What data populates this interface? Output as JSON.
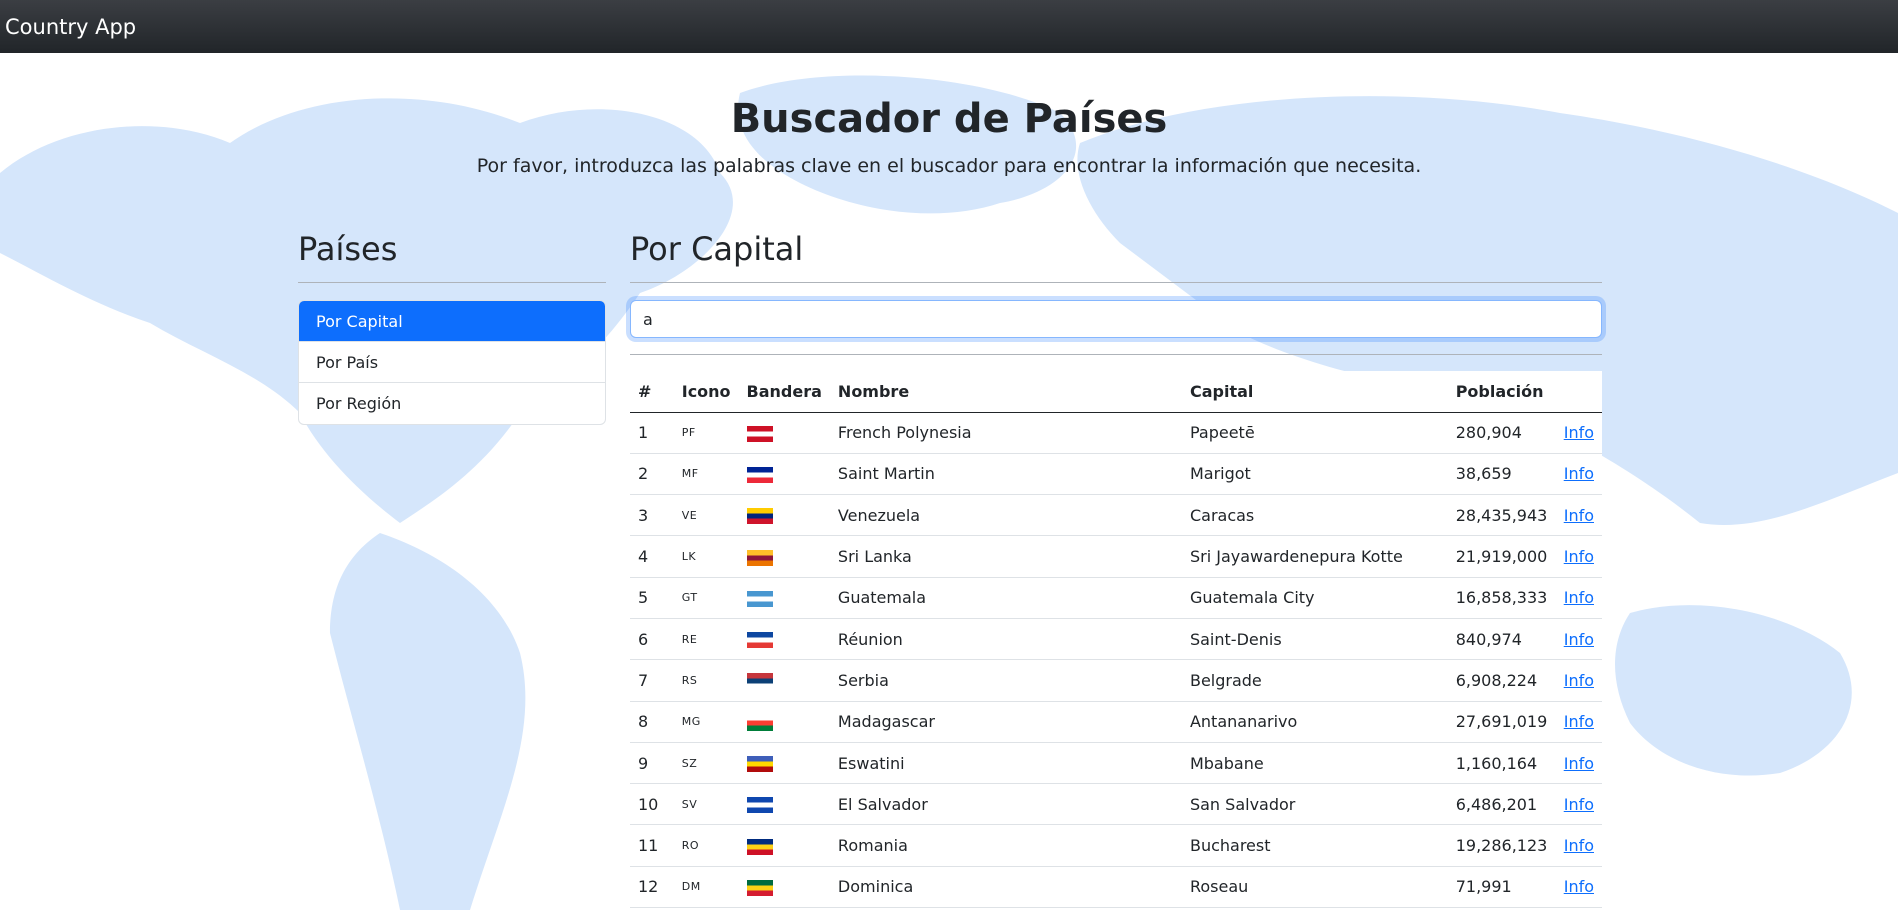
{
  "navbar": {
    "brand": "Country App"
  },
  "hero": {
    "title": "Buscador de Países",
    "subtitle": "Por favor, introduzca las palabras clave en el buscador para encontrar la información que necesita."
  },
  "sidebar": {
    "title": "Países",
    "items": [
      {
        "label": "Por Capital",
        "active": true
      },
      {
        "label": "Por País",
        "active": false
      },
      {
        "label": "Por Región",
        "active": false
      }
    ]
  },
  "main": {
    "title": "Por Capital",
    "search_value": "a"
  },
  "table": {
    "headers": [
      "#",
      "Icono",
      "Bandera",
      "Nombre",
      "Capital",
      "Población",
      ""
    ],
    "link_label": "Info",
    "rows": [
      {
        "num": "1",
        "code": "PF",
        "name": "French Polynesia",
        "capital": "Papeetē",
        "population": "280,904",
        "flag_colors": [
          "#ce1126",
          "#ffffff",
          "#ce1126"
        ]
      },
      {
        "num": "2",
        "code": "MF",
        "name": "Saint Martin",
        "capital": "Marigot",
        "population": "38,659",
        "flag_colors": [
          "#002395",
          "#ffffff",
          "#ed2939"
        ]
      },
      {
        "num": "3",
        "code": "VE",
        "name": "Venezuela",
        "capital": "Caracas",
        "population": "28,435,943",
        "flag_colors": [
          "#ffcc00",
          "#00247d",
          "#cf142b"
        ]
      },
      {
        "num": "4",
        "code": "LK",
        "name": "Sri Lanka",
        "capital": "Sri Jayawardenepura Kotte",
        "population": "21,919,000",
        "flag_colors": [
          "#ffbe29",
          "#8d153a",
          "#eb7400"
        ]
      },
      {
        "num": "5",
        "code": "GT",
        "name": "Guatemala",
        "capital": "Guatemala City",
        "population": "16,858,333",
        "flag_colors": [
          "#4997d0",
          "#ffffff",
          "#4997d0"
        ]
      },
      {
        "num": "6",
        "code": "RE",
        "name": "Réunion",
        "capital": "Saint-Denis",
        "population": "840,974",
        "flag_colors": [
          "#0d47a1",
          "#ffffff",
          "#e53935"
        ]
      },
      {
        "num": "7",
        "code": "RS",
        "name": "Serbia",
        "capital": "Belgrade",
        "population": "6,908,224",
        "flag_colors": [
          "#c6363c",
          "#0c4076",
          "#ffffff"
        ]
      },
      {
        "num": "8",
        "code": "MG",
        "name": "Madagascar",
        "capital": "Antananarivo",
        "population": "27,691,019",
        "flag_colors": [
          "#ffffff",
          "#fc3d32",
          "#007e3a"
        ]
      },
      {
        "num": "9",
        "code": "SZ",
        "name": "Eswatini",
        "capital": "Mbabane",
        "population": "1,160,164",
        "flag_colors": [
          "#3e5eb9",
          "#ffd900",
          "#b10c0c"
        ]
      },
      {
        "num": "10",
        "code": "SV",
        "name": "El Salvador",
        "capital": "San Salvador",
        "population": "6,486,201",
        "flag_colors": [
          "#0f47af",
          "#ffffff",
          "#0f47af"
        ]
      },
      {
        "num": "11",
        "code": "RO",
        "name": "Romania",
        "capital": "Bucharest",
        "population": "19,286,123",
        "flag_colors": [
          "#002b7f",
          "#fcd116",
          "#ce1126"
        ]
      },
      {
        "num": "12",
        "code": "DM",
        "name": "Dominica",
        "capital": "Roseau",
        "population": "71,991",
        "flag_colors": [
          "#006b3f",
          "#fcd116",
          "#d41c30"
        ]
      }
    ]
  },
  "colors": {
    "primary": "#0d6efd",
    "navbar": "#212529",
    "map": "#d5e6fb"
  }
}
